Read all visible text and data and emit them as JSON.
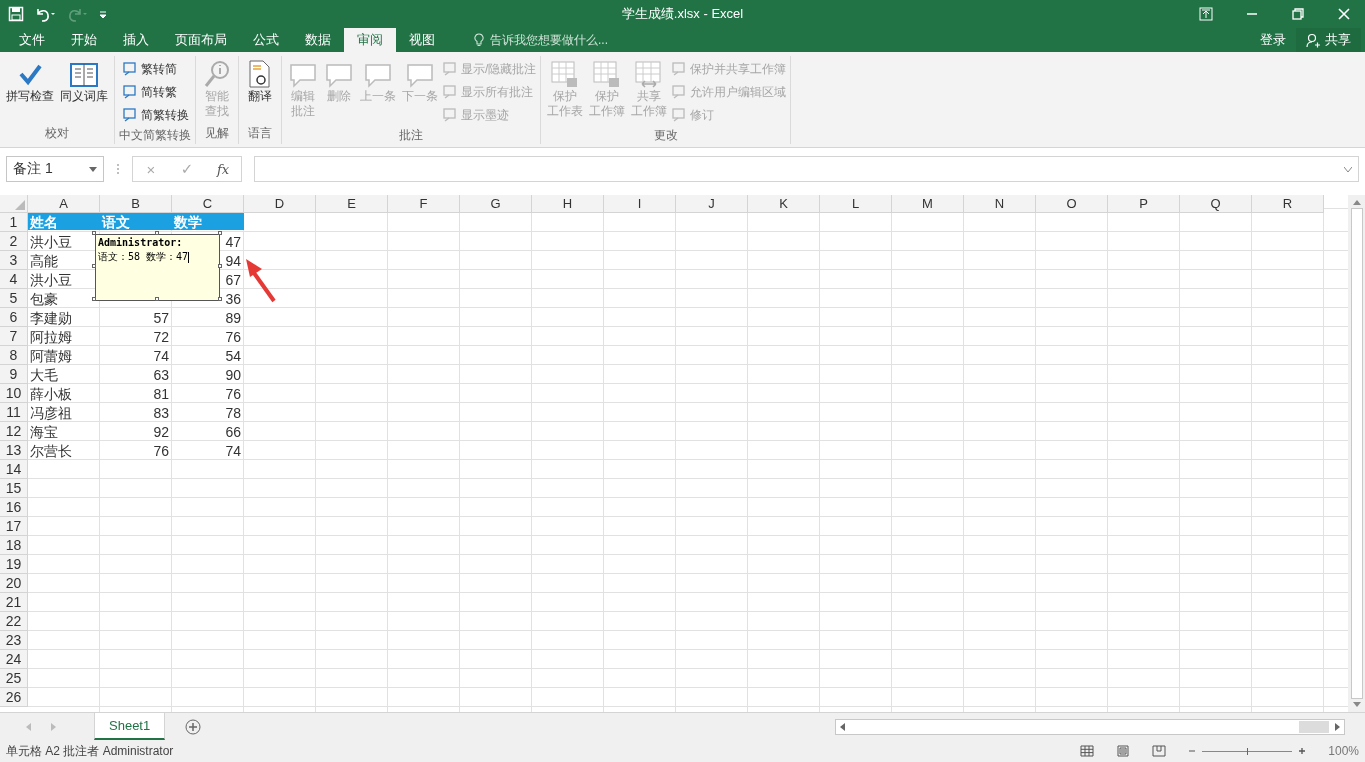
{
  "window": {
    "title": "学生成绩.xlsx - Excel"
  },
  "tabs": [
    {
      "label": "文件",
      "selected": false
    },
    {
      "label": "开始",
      "selected": false
    },
    {
      "label": "插入",
      "selected": false
    },
    {
      "label": "页面布局",
      "selected": false
    },
    {
      "label": "公式",
      "selected": false
    },
    {
      "label": "数据",
      "selected": false
    },
    {
      "label": "审阅",
      "selected": true
    },
    {
      "label": "视图",
      "selected": false
    }
  ],
  "tell_me": {
    "placeholder": "告诉我您想要做什么..."
  },
  "sign_in": "登录",
  "share": "共享",
  "ribbon": [
    {
      "label": "校对",
      "items": [
        {
          "kind": "large",
          "label": "拼写检查",
          "disabled": false
        },
        {
          "kind": "large",
          "label": "同义词库",
          "disabled": false
        }
      ]
    },
    {
      "label": "中文简繁转换",
      "items": [
        {
          "kind": "small",
          "label": "繁转简",
          "disabled": false
        },
        {
          "kind": "small",
          "label": "简转繁",
          "disabled": false
        },
        {
          "kind": "small",
          "label": "简繁转换",
          "disabled": false
        }
      ]
    },
    {
      "label": "见解",
      "items": [
        {
          "kind": "large",
          "label": "智能查找",
          "disabled": true
        }
      ]
    },
    {
      "label": "语言",
      "items": [
        {
          "kind": "large",
          "label": "翻译",
          "disabled": false
        }
      ]
    },
    {
      "label": "批注",
      "items": [
        {
          "kind": "large",
          "label": "编辑批注",
          "disabled": true
        },
        {
          "kind": "large",
          "label": "删除",
          "disabled": true
        },
        {
          "kind": "large",
          "label": "上一条",
          "disabled": true
        },
        {
          "kind": "large",
          "label": "下一条",
          "disabled": true
        },
        {
          "kind": "small",
          "label": "显示/隐藏批注",
          "disabled": true
        },
        {
          "kind": "small",
          "label": "显示所有批注",
          "disabled": true
        },
        {
          "kind": "small",
          "label": "显示墨迹",
          "disabled": true
        }
      ]
    },
    {
      "label": "更改",
      "items": [
        {
          "kind": "large",
          "label": "保护工作表",
          "disabled": true
        },
        {
          "kind": "large",
          "label": "保护工作簿",
          "disabled": true
        },
        {
          "kind": "large",
          "label": "共享工作簿",
          "disabled": true
        },
        {
          "kind": "small",
          "label": "保护并共享工作簿",
          "disabled": true
        },
        {
          "kind": "small",
          "label": "允许用户编辑区域",
          "disabled": true
        },
        {
          "kind": "small",
          "label": "修订",
          "disabled": true
        }
      ]
    }
  ],
  "formula_bar": {
    "name_box": "备注 1",
    "cancel": "×",
    "enter": "✓",
    "fx": "fx"
  },
  "table": {
    "columns": [
      "A",
      "B",
      "C",
      "D",
      "E",
      "F",
      "G",
      "H",
      "I",
      "J",
      "K",
      "L",
      "M",
      "N",
      "O",
      "P",
      "Q",
      "R"
    ],
    "rows": [
      {
        "number": "1",
        "kind": "header",
        "cells": [
          "姓名",
          "语文",
          "数学"
        ]
      },
      {
        "number": "2",
        "kind": "data",
        "cells": [
          "洪小豆",
          "",
          "47"
        ]
      },
      {
        "number": "3",
        "kind": "data",
        "cells": [
          "高能",
          "",
          "94"
        ]
      },
      {
        "number": "4",
        "kind": "data",
        "cells": [
          "洪小豆",
          "",
          "67"
        ]
      },
      {
        "number": "5",
        "kind": "data",
        "cells": [
          "包豪",
          "",
          "36"
        ]
      },
      {
        "number": "6",
        "kind": "data",
        "cells": [
          "李建勋",
          "57",
          "89"
        ]
      },
      {
        "number": "7",
        "kind": "data",
        "cells": [
          "阿拉姆",
          "72",
          "76"
        ]
      },
      {
        "number": "8",
        "kind": "data",
        "cells": [
          "阿蕾姆",
          "74",
          "54"
        ]
      },
      {
        "number": "9",
        "kind": "data",
        "cells": [
          "大毛",
          "63",
          "90"
        ]
      },
      {
        "number": "10",
        "kind": "data",
        "cells": [
          "薛小板",
          "81",
          "76"
        ]
      },
      {
        "number": "11",
        "kind": "data",
        "cells": [
          "冯彦祖",
          "83",
          "78"
        ]
      },
      {
        "number": "12",
        "kind": "data",
        "cells": [
          "海宝",
          "92",
          "66"
        ]
      },
      {
        "number": "13",
        "kind": "data",
        "cells": [
          "尔营长",
          "76",
          "74"
        ]
      },
      {
        "number": "14",
        "cells": []
      },
      {
        "number": "15",
        "cells": []
      },
      {
        "number": "16",
        "cells": []
      },
      {
        "number": "17",
        "cells": []
      },
      {
        "number": "18",
        "cells": []
      },
      {
        "number": "19",
        "cells": []
      },
      {
        "number": "20",
        "cells": []
      },
      {
        "number": "21",
        "cells": []
      },
      {
        "number": "22",
        "cells": []
      },
      {
        "number": "23",
        "cells": []
      },
      {
        "number": "24",
        "cells": []
      },
      {
        "number": "25",
        "cells": []
      },
      {
        "number": "26",
        "cells": []
      }
    ]
  },
  "comment": {
    "author": "Administrator:",
    "text": "语文：58 数学：47"
  },
  "sheets": [
    {
      "label": "Sheet1",
      "selected": true
    }
  ],
  "status_bar": {
    "text": "单元格 A2 批注者 Administrator",
    "zoom": {
      "level": 0.5
    },
    "zoom_text": "100%"
  }
}
